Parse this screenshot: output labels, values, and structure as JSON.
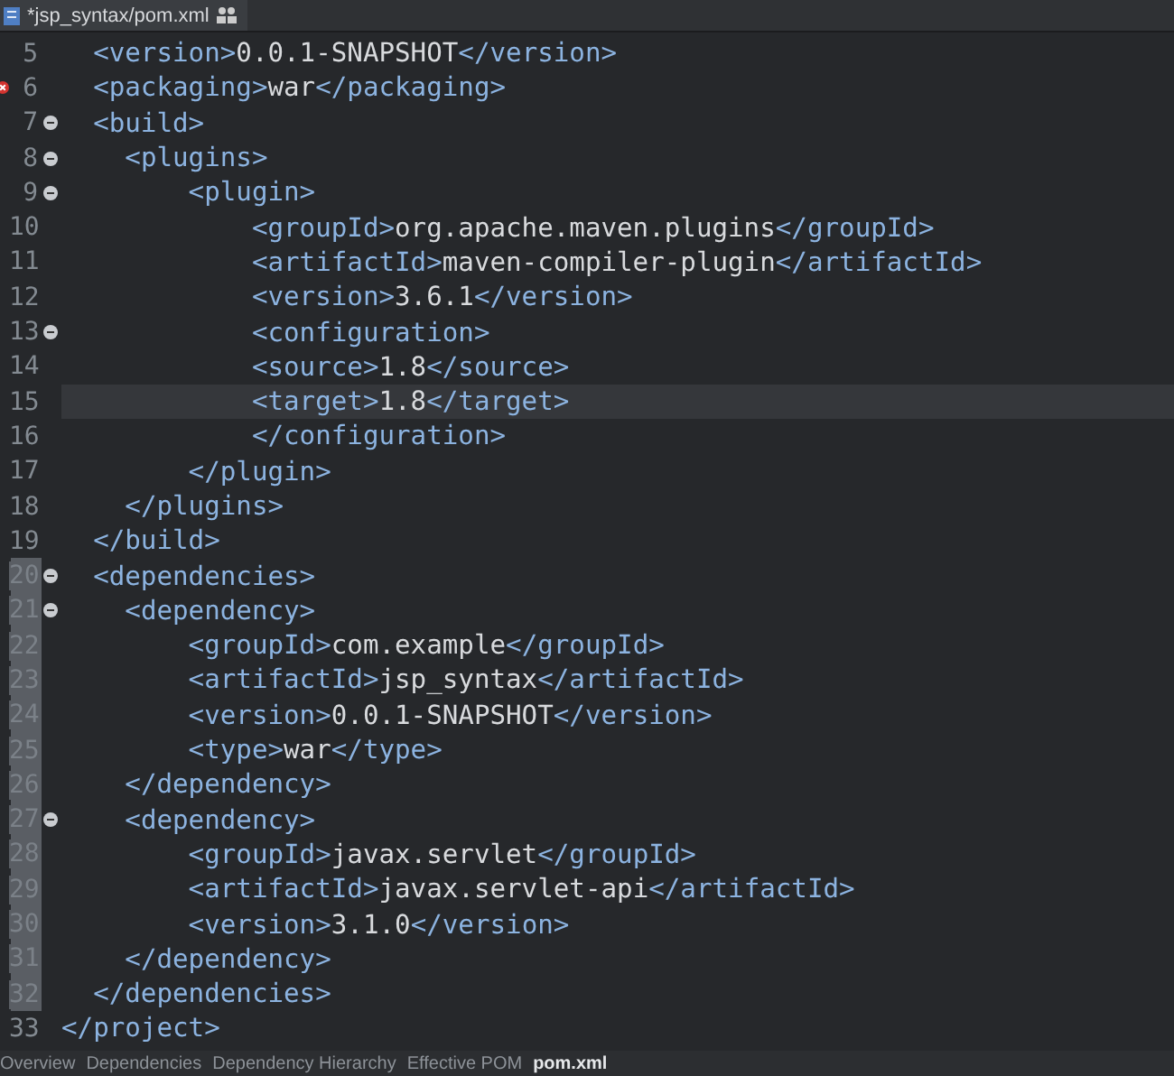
{
  "editor_tab": {
    "title": "*jsp_syntax/pom.xml"
  },
  "lines": [
    {
      "number": "5",
      "code": "  <version>0.0.1-SNAPSHOT</version>",
      "error": false,
      "fold": false,
      "current": false,
      "marked": false
    },
    {
      "number": "6",
      "code": "  <packaging>war</packaging>",
      "error": true,
      "fold": false,
      "current": false,
      "marked": false
    },
    {
      "number": "7",
      "code": "  <build>",
      "error": false,
      "fold": true,
      "current": false,
      "marked": false
    },
    {
      "number": "8",
      "code": "    <plugins>",
      "error": false,
      "fold": true,
      "current": false,
      "marked": false
    },
    {
      "number": "9",
      "code": "        <plugin>",
      "error": false,
      "fold": true,
      "current": false,
      "marked": false
    },
    {
      "number": "10",
      "code": "            <groupId>org.apache.maven.plugins</groupId>",
      "error": false,
      "fold": false,
      "current": false,
      "marked": false
    },
    {
      "number": "11",
      "code": "            <artifactId>maven-compiler-plugin</artifactId>",
      "error": false,
      "fold": false,
      "current": false,
      "marked": false
    },
    {
      "number": "12",
      "code": "            <version>3.6.1</version>",
      "error": false,
      "fold": false,
      "current": false,
      "marked": false
    },
    {
      "number": "13",
      "code": "            <configuration>",
      "error": false,
      "fold": true,
      "current": false,
      "marked": false
    },
    {
      "number": "14",
      "code": "            <source>1.8</source>",
      "error": false,
      "fold": false,
      "current": false,
      "marked": false
    },
    {
      "number": "15",
      "code": "            <target>1.8</target>",
      "error": false,
      "fold": false,
      "current": true,
      "marked": false
    },
    {
      "number": "16",
      "code": "            </configuration>",
      "error": false,
      "fold": false,
      "current": false,
      "marked": false
    },
    {
      "number": "17",
      "code": "        </plugin>",
      "error": false,
      "fold": false,
      "current": false,
      "marked": false
    },
    {
      "number": "18",
      "code": "    </plugins>",
      "error": false,
      "fold": false,
      "current": false,
      "marked": false
    },
    {
      "number": "19",
      "code": "  </build>",
      "error": false,
      "fold": false,
      "current": false,
      "marked": false
    },
    {
      "number": "20",
      "code": "  <dependencies>",
      "error": false,
      "fold": true,
      "current": false,
      "marked": true
    },
    {
      "number": "21",
      "code": "    <dependency>",
      "error": false,
      "fold": true,
      "current": false,
      "marked": true
    },
    {
      "number": "22",
      "code": "        <groupId>com.example</groupId>",
      "error": false,
      "fold": false,
      "current": false,
      "marked": true
    },
    {
      "number": "23",
      "code": "        <artifactId>jsp_syntax</artifactId>",
      "error": false,
      "fold": false,
      "current": false,
      "marked": true
    },
    {
      "number": "24",
      "code": "        <version>0.0.1-SNAPSHOT</version>",
      "error": false,
      "fold": false,
      "current": false,
      "marked": true
    },
    {
      "number": "25",
      "code": "        <type>war</type>",
      "error": false,
      "fold": false,
      "current": false,
      "marked": true
    },
    {
      "number": "26",
      "code": "    </dependency>",
      "error": false,
      "fold": false,
      "current": false,
      "marked": true
    },
    {
      "number": "27",
      "code": "    <dependency>",
      "error": false,
      "fold": true,
      "current": false,
      "marked": true
    },
    {
      "number": "28",
      "code": "        <groupId>javax.servlet</groupId>",
      "error": false,
      "fold": false,
      "current": false,
      "marked": true
    },
    {
      "number": "29",
      "code": "        <artifactId>javax.servlet-api</artifactId>",
      "error": false,
      "fold": false,
      "current": false,
      "marked": true
    },
    {
      "number": "30",
      "code": "        <version>3.1.0</version>",
      "error": false,
      "fold": false,
      "current": false,
      "marked": true
    },
    {
      "number": "31",
      "code": "    </dependency>",
      "error": false,
      "fold": false,
      "current": false,
      "marked": true
    },
    {
      "number": "32",
      "code": "  </dependencies>",
      "error": false,
      "fold": false,
      "current": false,
      "marked": true
    },
    {
      "number": "33",
      "code": "</project>",
      "error": false,
      "fold": false,
      "current": false,
      "marked": false
    }
  ],
  "bottom_tabs": [
    {
      "label": "Overview",
      "selected": false
    },
    {
      "label": "Dependencies",
      "selected": false
    },
    {
      "label": "Dependency Hierarchy",
      "selected": false
    },
    {
      "label": "Effective POM",
      "selected": false
    },
    {
      "label": "pom.xml",
      "selected": true
    }
  ]
}
